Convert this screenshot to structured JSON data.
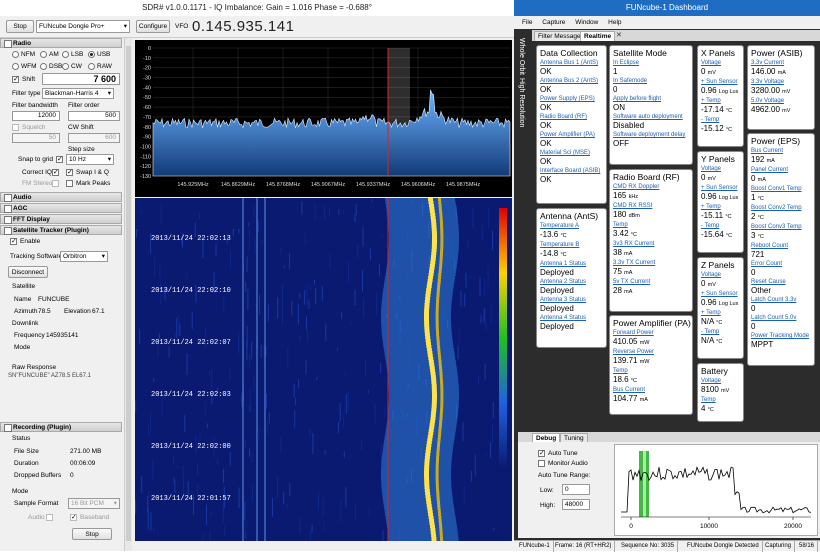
{
  "sdr": {
    "window_title": "SDR# v1.0.0.1171 - IQ Imbalance: Gain = 1.016 Phase = -0.688°",
    "stop_label": "Stop",
    "device": "FUNcube Dongle Pro+",
    "configure_label": "Configure",
    "vfo_label": "VFO",
    "vfo_value": "0.145.935.141",
    "radio": {
      "section": "Radio",
      "modes": [
        "NFM",
        "AM",
        "LSB",
        "USB",
        "WFM",
        "DSB",
        "CW",
        "RAW"
      ],
      "selected_mode": "USB",
      "shift_label": "Shift",
      "shift_value": "7 600",
      "filter_type_label": "Filter type",
      "filter_type": "Blackman-Harris 4",
      "filter_bw_label": "Filter bandwidth",
      "filter_bw": "12000",
      "filter_order_label": "Filter order",
      "filter_order": "500",
      "squelch_label": "Squelch",
      "squelch": "50",
      "cw_shift_label": "CW Shift",
      "cw_shift": "600",
      "step_size_label": "Step size",
      "snap_label": "Snap to grid",
      "step_size": "10 Hz",
      "correct_iq_label": "Correct IQ",
      "swap_iq_label": "Swap I & Q",
      "fm_stereo_label": "FM Stereo",
      "mark_peaks_label": "Mark Peaks"
    },
    "sections": [
      "Audio",
      "AGC",
      "FFT Display",
      "Satellite Tracker (Plugin)"
    ],
    "tracker": {
      "enable_label": "Enable",
      "software_label": "Tracking Software",
      "software": "Orbitron",
      "disconnect_label": "Disconnect",
      "satellite_heading": "Satellite",
      "name_label": "Name",
      "name": "FUNCUBE",
      "azimuth_label": "Azimuth",
      "azimuth": "78.5",
      "elevation_label": "Elevation",
      "elevation": "67.1",
      "downlink_label": "Downlink",
      "frequency_label": "Frequency",
      "frequency": "145935141",
      "mode_label": "Mode",
      "raw_response_label": "Raw Response",
      "raw_response": "SN\"FUNCUBE\" AZ78.5 EL67.1"
    },
    "recording": {
      "section": "Recording (Plugin)",
      "status_heading": "Status",
      "file_size_label": "File Size",
      "file_size": "271.00 MB",
      "duration_label": "Duration",
      "duration": "00:06:09",
      "dropped_label": "Dropped Buffers",
      "dropped": "0",
      "mode_heading": "Mode",
      "sample_format_label": "Sample Format",
      "sample_format": "16 Bit PCM",
      "audio_label": "Audio",
      "baseband_label": "Baseband",
      "stop_label": "Stop"
    },
    "spectrum": {
      "y_ticks": [
        "0",
        "-10",
        "-20",
        "-30",
        "-40",
        "-50",
        "-60",
        "-70",
        "-80",
        "-90",
        "-100",
        "-110",
        "-120",
        "-130"
      ],
      "x_ticks": [
        "145.925MHz",
        "145.8629MHz",
        "145.8768MHz",
        "145.9067MHz",
        "145.9337MHz",
        "145.9606MHz",
        "145.9875MHz"
      ]
    },
    "waterfall_times": [
      "2013/11/24 22:02:13",
      "2013/11/24 22:02:10",
      "2013/11/24 22:02:07",
      "2013/11/24 22:02:03",
      "2013/11/24 22:02:00",
      "2013/11/24 22:01:57"
    ]
  },
  "dash": {
    "window_title": "FUNcube-1 Dashboard",
    "menu": [
      "File",
      "Capture",
      "Window",
      "Help"
    ],
    "tabs": [
      "Filter Messages",
      "Realtime"
    ],
    "vtabs": [
      "Whole Orbit",
      "High Resolution"
    ],
    "data_collection": {
      "title": "Data Collection",
      "items": [
        {
          "label": "Antenna Bus 1 (AntS)",
          "value": "OK"
        },
        {
          "label": "Antenna Bus 2 (AntS)",
          "value": "OK"
        },
        {
          "label": "Power Supply (EPS)",
          "value": "OK"
        },
        {
          "label": "Radio Board (RF)",
          "value": "OK"
        },
        {
          "label": "Power Amplifier (PA)",
          "value": "OK"
        },
        {
          "label": "Material Sci (MSE)",
          "value": "OK"
        },
        {
          "label": "Interface Board (ASIB)",
          "value": "OK"
        }
      ]
    },
    "satellite_mode": {
      "title": "Satellite Mode",
      "items": [
        {
          "label": "In Eclipse",
          "value": "1"
        },
        {
          "label": "In Safemode",
          "value": "0"
        },
        {
          "label": "Apply before flight",
          "value": "ON"
        },
        {
          "label": "Software auto deployment",
          "value": "Disabled"
        },
        {
          "label": "Software deployment delay",
          "value": "OFF"
        }
      ]
    },
    "x_panels": {
      "title": "X Panels",
      "items": [
        {
          "label": "Voltage",
          "value": "0",
          "unit": "mV"
        },
        {
          "label": "+ Sun Sensor",
          "value": "0.96",
          "unit": "Log Lux"
        },
        {
          "label": "+ Temp",
          "value": "-17.14",
          "unit": "°C"
        },
        {
          "label": "- Temp",
          "value": "-15.12",
          "unit": "°C"
        }
      ]
    },
    "power_asib": {
      "title": "Power (ASIB)",
      "items": [
        {
          "label": "3.3v Current",
          "value": "146.00",
          "unit": "mA"
        },
        {
          "label": "3.3v Voltage",
          "value": "3280.00",
          "unit": "mV"
        },
        {
          "label": "5.0v Voltage",
          "value": "4962.00",
          "unit": "mV"
        }
      ]
    },
    "radio_board": {
      "title": "Radio Board (RF)",
      "items": [
        {
          "label": "CMD RX Doppler",
          "value": "165",
          "unit": "kHz"
        },
        {
          "label": "CMD RX RSSI",
          "value": "180",
          "unit": "dBm"
        },
        {
          "label": "Temp",
          "value": "3.42",
          "unit": "°C"
        },
        {
          "label": "3v3 RX Current",
          "value": "38",
          "unit": "mA"
        },
        {
          "label": "3.3v TX Current",
          "value": "75",
          "unit": "mA"
        },
        {
          "label": "5v TX Current",
          "value": "28",
          "unit": "mA"
        }
      ]
    },
    "y_panels": {
      "title": "Y Panels",
      "items": [
        {
          "label": "Voltage",
          "value": "0",
          "unit": "mV"
        },
        {
          "label": "+ Sun Sensor",
          "value": "0.96",
          "unit": "Log Lux"
        },
        {
          "label": "+ Temp",
          "value": "-15.11",
          "unit": "°C"
        },
        {
          "label": "- Temp",
          "value": "-15.64",
          "unit": "°C"
        }
      ]
    },
    "power_eps": {
      "title": "Power (EPS)",
      "items": [
        {
          "label": "Bus Current",
          "value": "192",
          "unit": "mA"
        },
        {
          "label": "Panel Current",
          "value": "0",
          "unit": "mA"
        },
        {
          "label": "Boost Conv1 Temp",
          "value": "1",
          "unit": "°C"
        },
        {
          "label": "Boost Conv2 Temp",
          "value": "2",
          "unit": "°C"
        },
        {
          "label": "Boost Conv3 Temp",
          "value": "3",
          "unit": "°C"
        },
        {
          "label": "Reboot Count",
          "value": "721",
          "unit": ""
        },
        {
          "label": "Error Count",
          "value": "0",
          "unit": ""
        },
        {
          "label": "Reset Cause",
          "value": "Other",
          "unit": ""
        },
        {
          "label": "Latch Count 3.3v",
          "value": "0",
          "unit": ""
        },
        {
          "label": "Latch Count 5.0v",
          "value": "0",
          "unit": ""
        },
        {
          "label": "Power Tracking Mode",
          "value": "MPPT",
          "unit": ""
        }
      ]
    },
    "antenna": {
      "title": "Antenna (AntS)",
      "items": [
        {
          "label": "Temperature A",
          "value": "-13.6",
          "unit": "°C"
        },
        {
          "label": "Temperature B",
          "value": "-14.8",
          "unit": "°C"
        },
        {
          "label": "Antenna 1 Status",
          "value": "Deployed",
          "unit": ""
        },
        {
          "label": "Antenna 2 Status",
          "value": "Deployed",
          "unit": ""
        },
        {
          "label": "Antenna 3 Status",
          "value": "Deployed",
          "unit": ""
        },
        {
          "label": "Antenna 4 Status",
          "value": "Deployed",
          "unit": ""
        }
      ]
    },
    "z_panels": {
      "title": "Z Panels",
      "items": [
        {
          "label": "Voltage",
          "value": "0",
          "unit": "mV"
        },
        {
          "label": "+ Sun Sensor",
          "value": "0.96",
          "unit": "Log Lux"
        },
        {
          "label": "+ Temp",
          "value": "N/A",
          "unit": "°C"
        },
        {
          "label": "- Temp",
          "value": "N/A",
          "unit": "°C"
        }
      ]
    },
    "power_amp": {
      "title": "Power Amplifier (PA)",
      "items": [
        {
          "label": "Forward Power",
          "value": "410.05",
          "unit": "mW"
        },
        {
          "label": "Reverse Power",
          "value": "139.71",
          "unit": "mW"
        },
        {
          "label": "Temp",
          "value": "18.6",
          "unit": "°C"
        },
        {
          "label": "Bus Current",
          "value": "104.77",
          "unit": "mA"
        }
      ]
    },
    "battery": {
      "title": "Battery",
      "items": [
        {
          "label": "Voltage",
          "value": "8100",
          "unit": "mV"
        },
        {
          "label": "Temp",
          "value": "4",
          "unit": "°C"
        }
      ]
    },
    "debug": {
      "tabs": [
        "Debug",
        "Tuning"
      ],
      "auto_tune_label": "Auto Tune",
      "monitor_audio_label": "Monitor Audio",
      "range_label": "Auto Tune Range:",
      "low_label": "Low:",
      "low": "0",
      "high_label": "High:",
      "high": "48000",
      "graph_ticks": [
        "0",
        "10000",
        "20000"
      ]
    },
    "status": [
      "FUNcube-1",
      "Frame: 16 (RT+HR2)",
      "Sequence No: 3035",
      "FUNcube Dongle Detected",
      "Capturing",
      "58/16"
    ]
  },
  "colors": {
    "dash_bg": "#2c2c2c",
    "dash_title": "#1f6dc2",
    "link": "#1a5fb4",
    "spectrum_fill": "#2a6fb8",
    "marker": "#e02020"
  }
}
